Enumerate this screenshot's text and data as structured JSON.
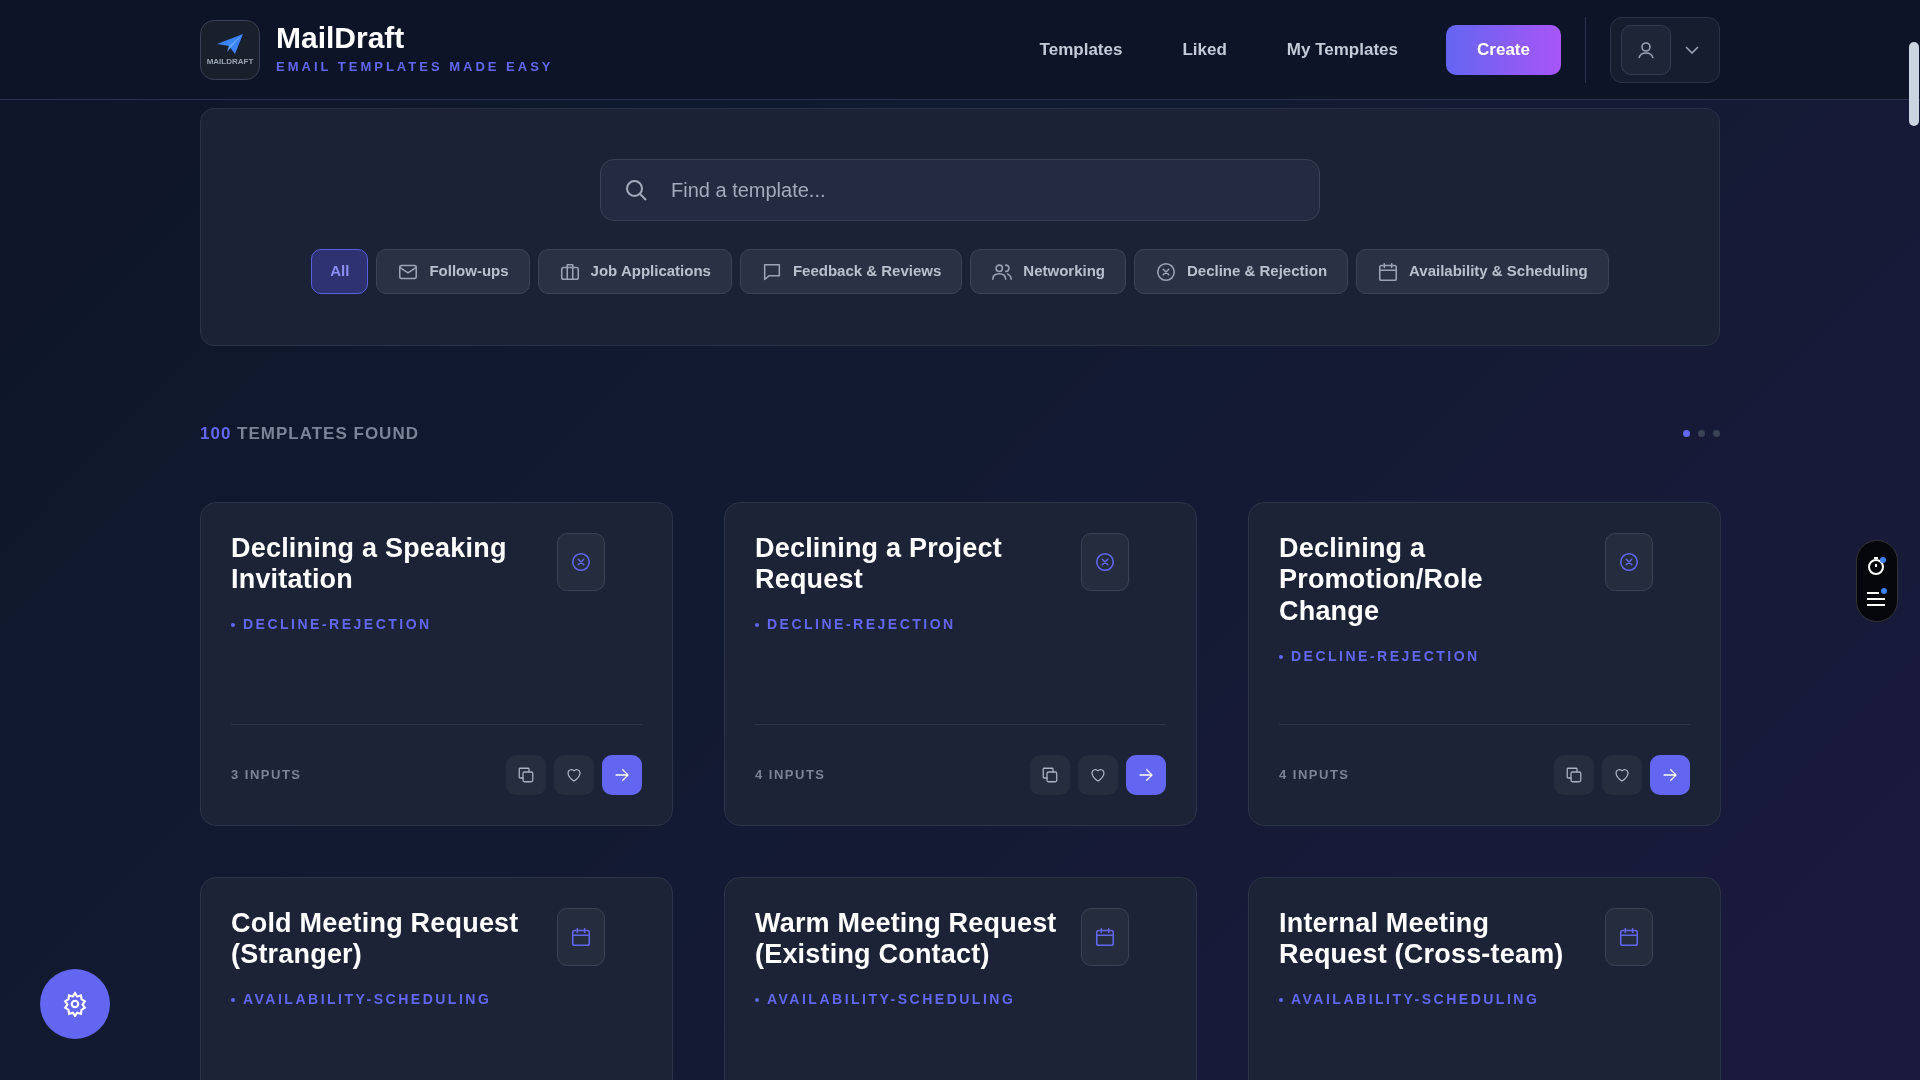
{
  "brand": {
    "name": "MailDraft",
    "tagline": "EMAIL TEMPLATES MADE EASY",
    "logo_text": "MAILDRAFT"
  },
  "nav": [
    {
      "label": "Templates"
    },
    {
      "label": "Liked"
    },
    {
      "label": "My Templates"
    }
  ],
  "create_button": "Create",
  "search": {
    "placeholder": "Find a template..."
  },
  "filters": [
    {
      "label": "All",
      "kind": "none",
      "selected": true
    },
    {
      "label": "Follow-ups",
      "kind": "mail",
      "selected": false
    },
    {
      "label": "Job Applications",
      "kind": "briefcase",
      "selected": false
    },
    {
      "label": "Feedback & Reviews",
      "kind": "chat",
      "selected": false
    },
    {
      "label": "Networking",
      "kind": "people",
      "selected": false
    },
    {
      "label": "Decline & Rejection",
      "kind": "decline",
      "selected": false
    },
    {
      "label": "Availability & Scheduling",
      "kind": "calendar",
      "selected": false
    }
  ],
  "results": {
    "count": "100",
    "label": "TEMPLATES FOUND"
  },
  "pages": [
    {
      "selected": true
    },
    {
      "selected": false
    },
    {
      "selected": false
    }
  ],
  "cards": [
    {
      "title": "Declining a Speaking Invitation",
      "category": "DECLINE-REJECTION",
      "kind": "decline",
      "inputs": "3 INPUTS"
    },
    {
      "title": "Declining a Project Request",
      "category": "DECLINE-REJECTION",
      "kind": "decline",
      "inputs": "4 INPUTS"
    },
    {
      "title": "Declining a Promotion/Role Change",
      "category": "DECLINE-REJECTION",
      "kind": "decline",
      "inputs": "4 INPUTS"
    },
    {
      "title": "Cold Meeting Request (Stranger)",
      "category": "AVAILABILITY-SCHEDULING",
      "kind": "calendar"
    },
    {
      "title": "Warm Meeting Request (Existing Contact)",
      "category": "AVAILABILITY-SCHEDULING",
      "kind": "calendar"
    },
    {
      "title": "Internal Meeting Request (Cross-team)",
      "category": "AVAILABILITY-SCHEDULING",
      "kind": "calendar"
    }
  ]
}
